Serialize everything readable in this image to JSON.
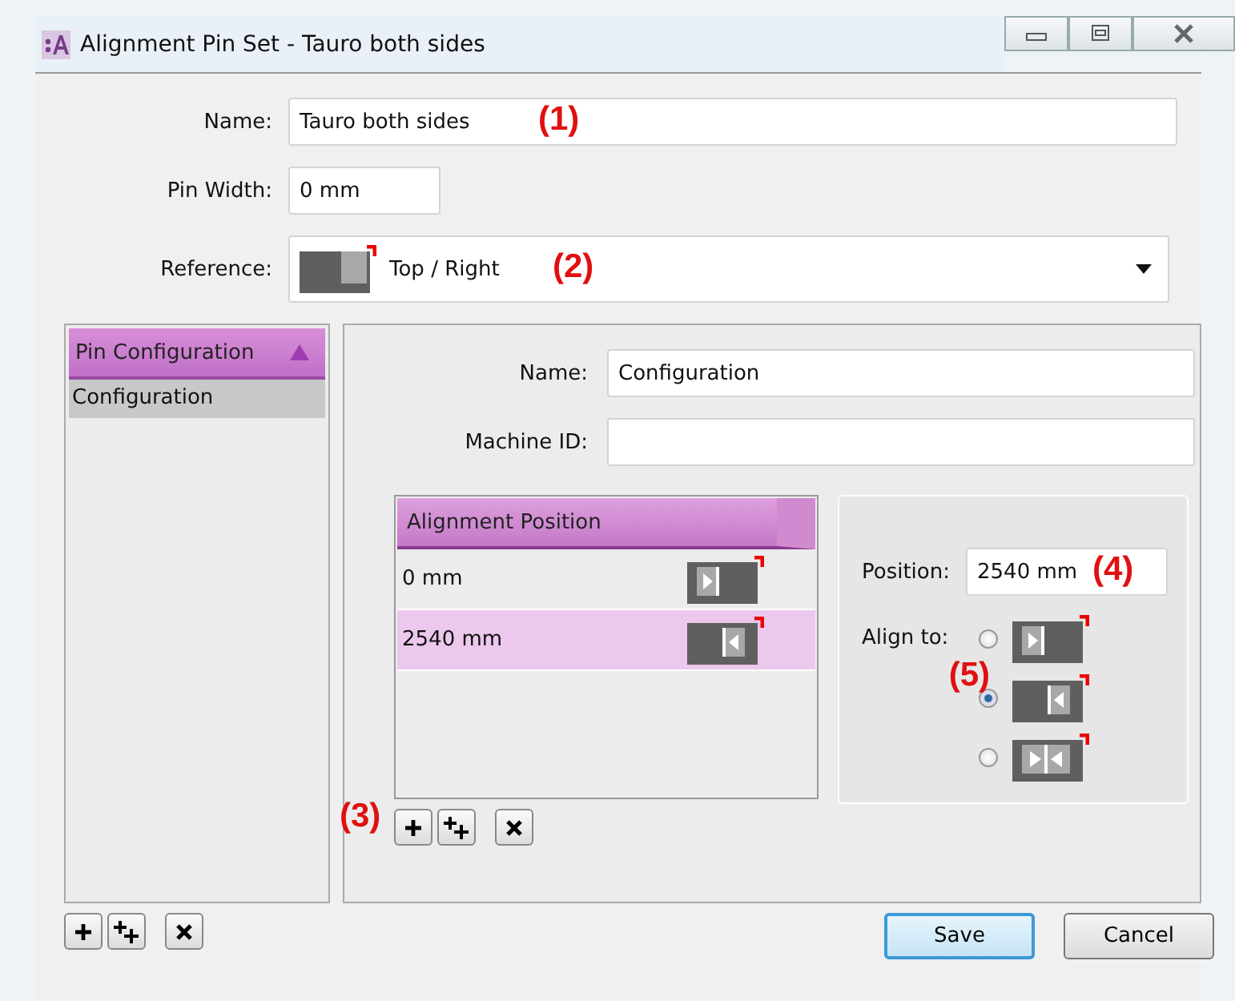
{
  "window": {
    "title": "Alignment Pin Set - Tauro both sides"
  },
  "name": {
    "label": "Name:",
    "value": "Tauro both sides",
    "annotation": "(1)"
  },
  "pin_width": {
    "label": "Pin Width:",
    "value": "0 mm"
  },
  "reference": {
    "label": "Reference:",
    "value": "Top / Right",
    "kind": "top-right",
    "annotation": "(2)"
  },
  "pin_configuration": {
    "header": "Pin Configuration",
    "items": [
      {
        "label": "Configuration",
        "selected": true
      }
    ]
  },
  "configuration": {
    "name_label": "Name:",
    "name_value": "Configuration",
    "machine_id_label": "Machine ID:"
  },
  "alignment_positions": {
    "header": "Alignment Position",
    "annotation": "(3)",
    "rows": [
      {
        "position": "0 mm",
        "kind": "right",
        "selected": false
      },
      {
        "position": "2540 mm",
        "kind": "left",
        "selected": true
      }
    ]
  },
  "position_editor": {
    "position_label": "Position:",
    "position_value": "2540 mm",
    "position_annotation": "(4)",
    "align_label": "Align to:",
    "options_annotation": "(5)",
    "options": [
      {
        "kind": "right",
        "selected": false
      },
      {
        "kind": "left",
        "selected": true
      },
      {
        "kind": "both",
        "selected": false
      }
    ]
  },
  "buttons": [
    {
      "label": "Save",
      "default": true
    },
    {
      "label": "Cancel",
      "default": false
    }
  ]
}
